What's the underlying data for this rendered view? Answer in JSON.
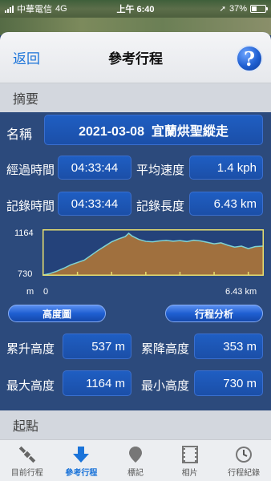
{
  "status": {
    "carrier": "中華電信",
    "network": "4G",
    "time": "上午 6:40",
    "battery_pct": "37%",
    "battery_level": 0.37
  },
  "nav": {
    "back_label": "返回",
    "title": "參考行程",
    "help_label": "?"
  },
  "summary": {
    "header": "摘要",
    "name_label": "名稱",
    "name_value": "2021-03-08  宜蘭烘聖縱走",
    "elapsed_label": "經過時間",
    "elapsed_value": "04:33:44",
    "avg_speed_label": "平均速度",
    "avg_speed_value": "1.4 kph",
    "recorded_label": "記錄時間",
    "recorded_value": "04:33:44",
    "distance_label": "記錄長度",
    "distance_value": "6.43 km",
    "ascent_label": "累升高度",
    "ascent_value": "537 m",
    "descent_label": "累降高度",
    "descent_value": "353 m",
    "max_alt_label": "最大高度",
    "max_alt_value": "1164 m",
    "min_alt_label": "最小高度",
    "min_alt_value": "730 m"
  },
  "elevation": {
    "y_max_label": "1164",
    "y_min_label": "730",
    "x_unit": "m",
    "x_start_label": "0",
    "x_end_label": "6.43 km"
  },
  "chart_data": {
    "type": "area",
    "title": "",
    "xlabel": "",
    "ylabel": "",
    "xlim": [
      0,
      6.43
    ],
    "ylim": [
      730,
      1164
    ],
    "x": [
      0,
      0.2,
      0.4,
      0.6,
      0.8,
      1.0,
      1.2,
      1.4,
      1.6,
      1.8,
      2.0,
      2.2,
      2.4,
      2.5,
      2.6,
      2.8,
      3.0,
      3.2,
      3.4,
      3.6,
      3.8,
      4.0,
      4.2,
      4.4,
      4.6,
      4.8,
      5.0,
      5.2,
      5.4,
      5.6,
      5.8,
      6.0,
      6.2,
      6.43
    ],
    "values": [
      730,
      745,
      770,
      800,
      835,
      860,
      885,
      935,
      985,
      1030,
      1075,
      1105,
      1130,
      1164,
      1135,
      1100,
      1080,
      1075,
      1085,
      1090,
      1082,
      1088,
      1078,
      1092,
      1085,
      1070,
      1055,
      1065,
      1040,
      1020,
      1030,
      1005,
      1025,
      1030
    ],
    "grid": false,
    "legend": "none",
    "colors": {
      "fill": "#a0703e",
      "line": "#7fd3d3",
      "axis": "#e8e070",
      "background": "#24427a"
    }
  },
  "buttons": {
    "elevation_chart": "高度圖",
    "trip_analysis": "行程分析"
  },
  "start": {
    "header": "起點"
  },
  "tabs": [
    {
      "label": "目前行程",
      "icon": "satellite-icon"
    },
    {
      "label": "參考行程",
      "icon": "download-arrow-icon"
    },
    {
      "label": "標記",
      "icon": "map-pin-icon"
    },
    {
      "label": "相片",
      "icon": "film-icon"
    },
    {
      "label": "行程紀錄",
      "icon": "clock-icon"
    }
  ]
}
